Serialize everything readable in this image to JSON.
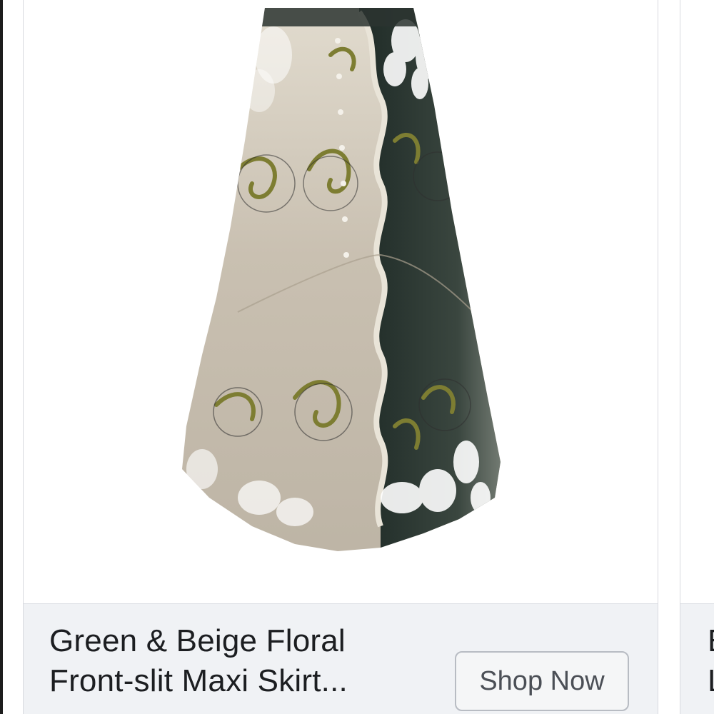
{
  "ad_card": {
    "title_line_1": "Green & Beige Floral",
    "title_line_2": "Front-slit Maxi Skirt...",
    "subtext": "",
    "cta_label": "Shop Now",
    "image": "product-photo-maxi-skirt"
  },
  "next_card": {
    "title_line_1": "E",
    "title_line_2": "L"
  },
  "colors": {
    "footer_bg": "#f0f2f5",
    "card_border": "#d8dadf",
    "title_text": "#1c1e21",
    "button_border": "#b8bcc3",
    "button_text": "#4b4f56",
    "skirt_beige": "#cfc6b6",
    "skirt_dark_green": "#2f3a35",
    "scroll_olive": "#8a8a3a"
  }
}
